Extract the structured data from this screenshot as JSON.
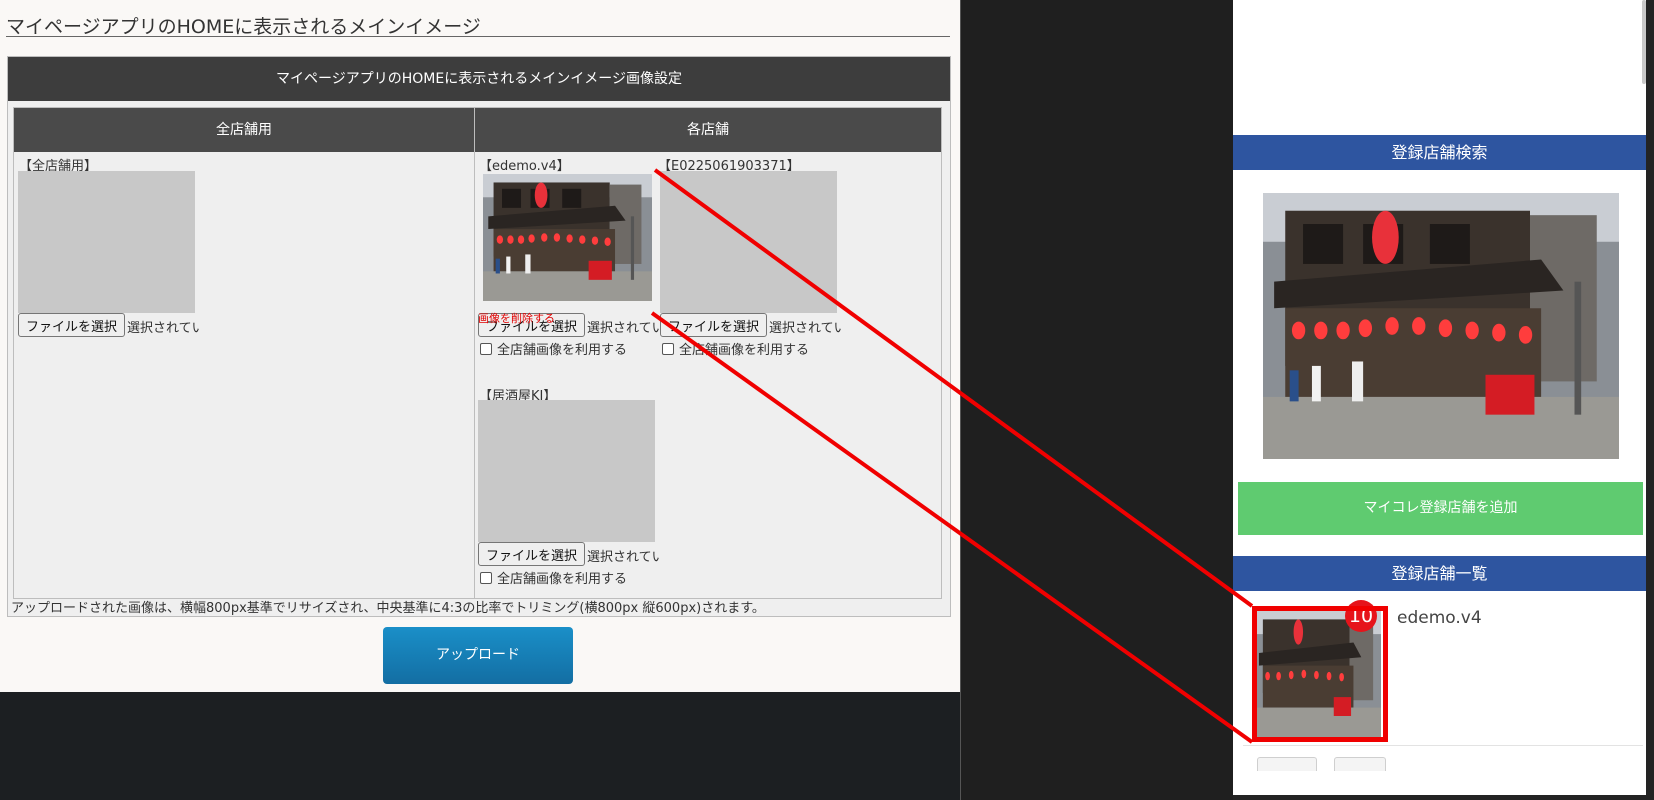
{
  "admin": {
    "title": "マイページアプリのHOMEに表示されるメインイメージ",
    "panel_header": "マイページアプリのHOMEに表示されるメインイメージ画像設定",
    "col_all": "全店舗用",
    "col_each": "各店舗",
    "stores": [
      {
        "label": "【全店舗用】",
        "has_image": false
      },
      {
        "label": "【edemo.v4】",
        "has_image": true
      },
      {
        "label": "【E0225061903371】",
        "has_image": false
      },
      {
        "label": "【居酒屋KJ】",
        "has_image": false
      }
    ],
    "file_button": "ファイルを選択",
    "file_status": "選択されていません",
    "use_all_image": "全店舗画像を利用する",
    "delete_image": "画像を削除する",
    "note": "アップロードされた画像は、横幅800px基準でリサイズされ、中央基準に4:3の比率でトリミング(横800px 縦600px)されます。",
    "upload_button": "アップロード"
  },
  "app": {
    "search_header": "登録店舗検索",
    "add_button": "マイコレ登録店舗を追加",
    "list_header": "登録店舗一覧",
    "list_items": [
      {
        "name": "edemo.v4",
        "badge": "10"
      }
    ]
  },
  "colors": {
    "accent_blue": "#2e55a0",
    "add_green": "#5fcb70",
    "annotation_red": "#f00000",
    "upload_blue": "#1a8fc8"
  }
}
